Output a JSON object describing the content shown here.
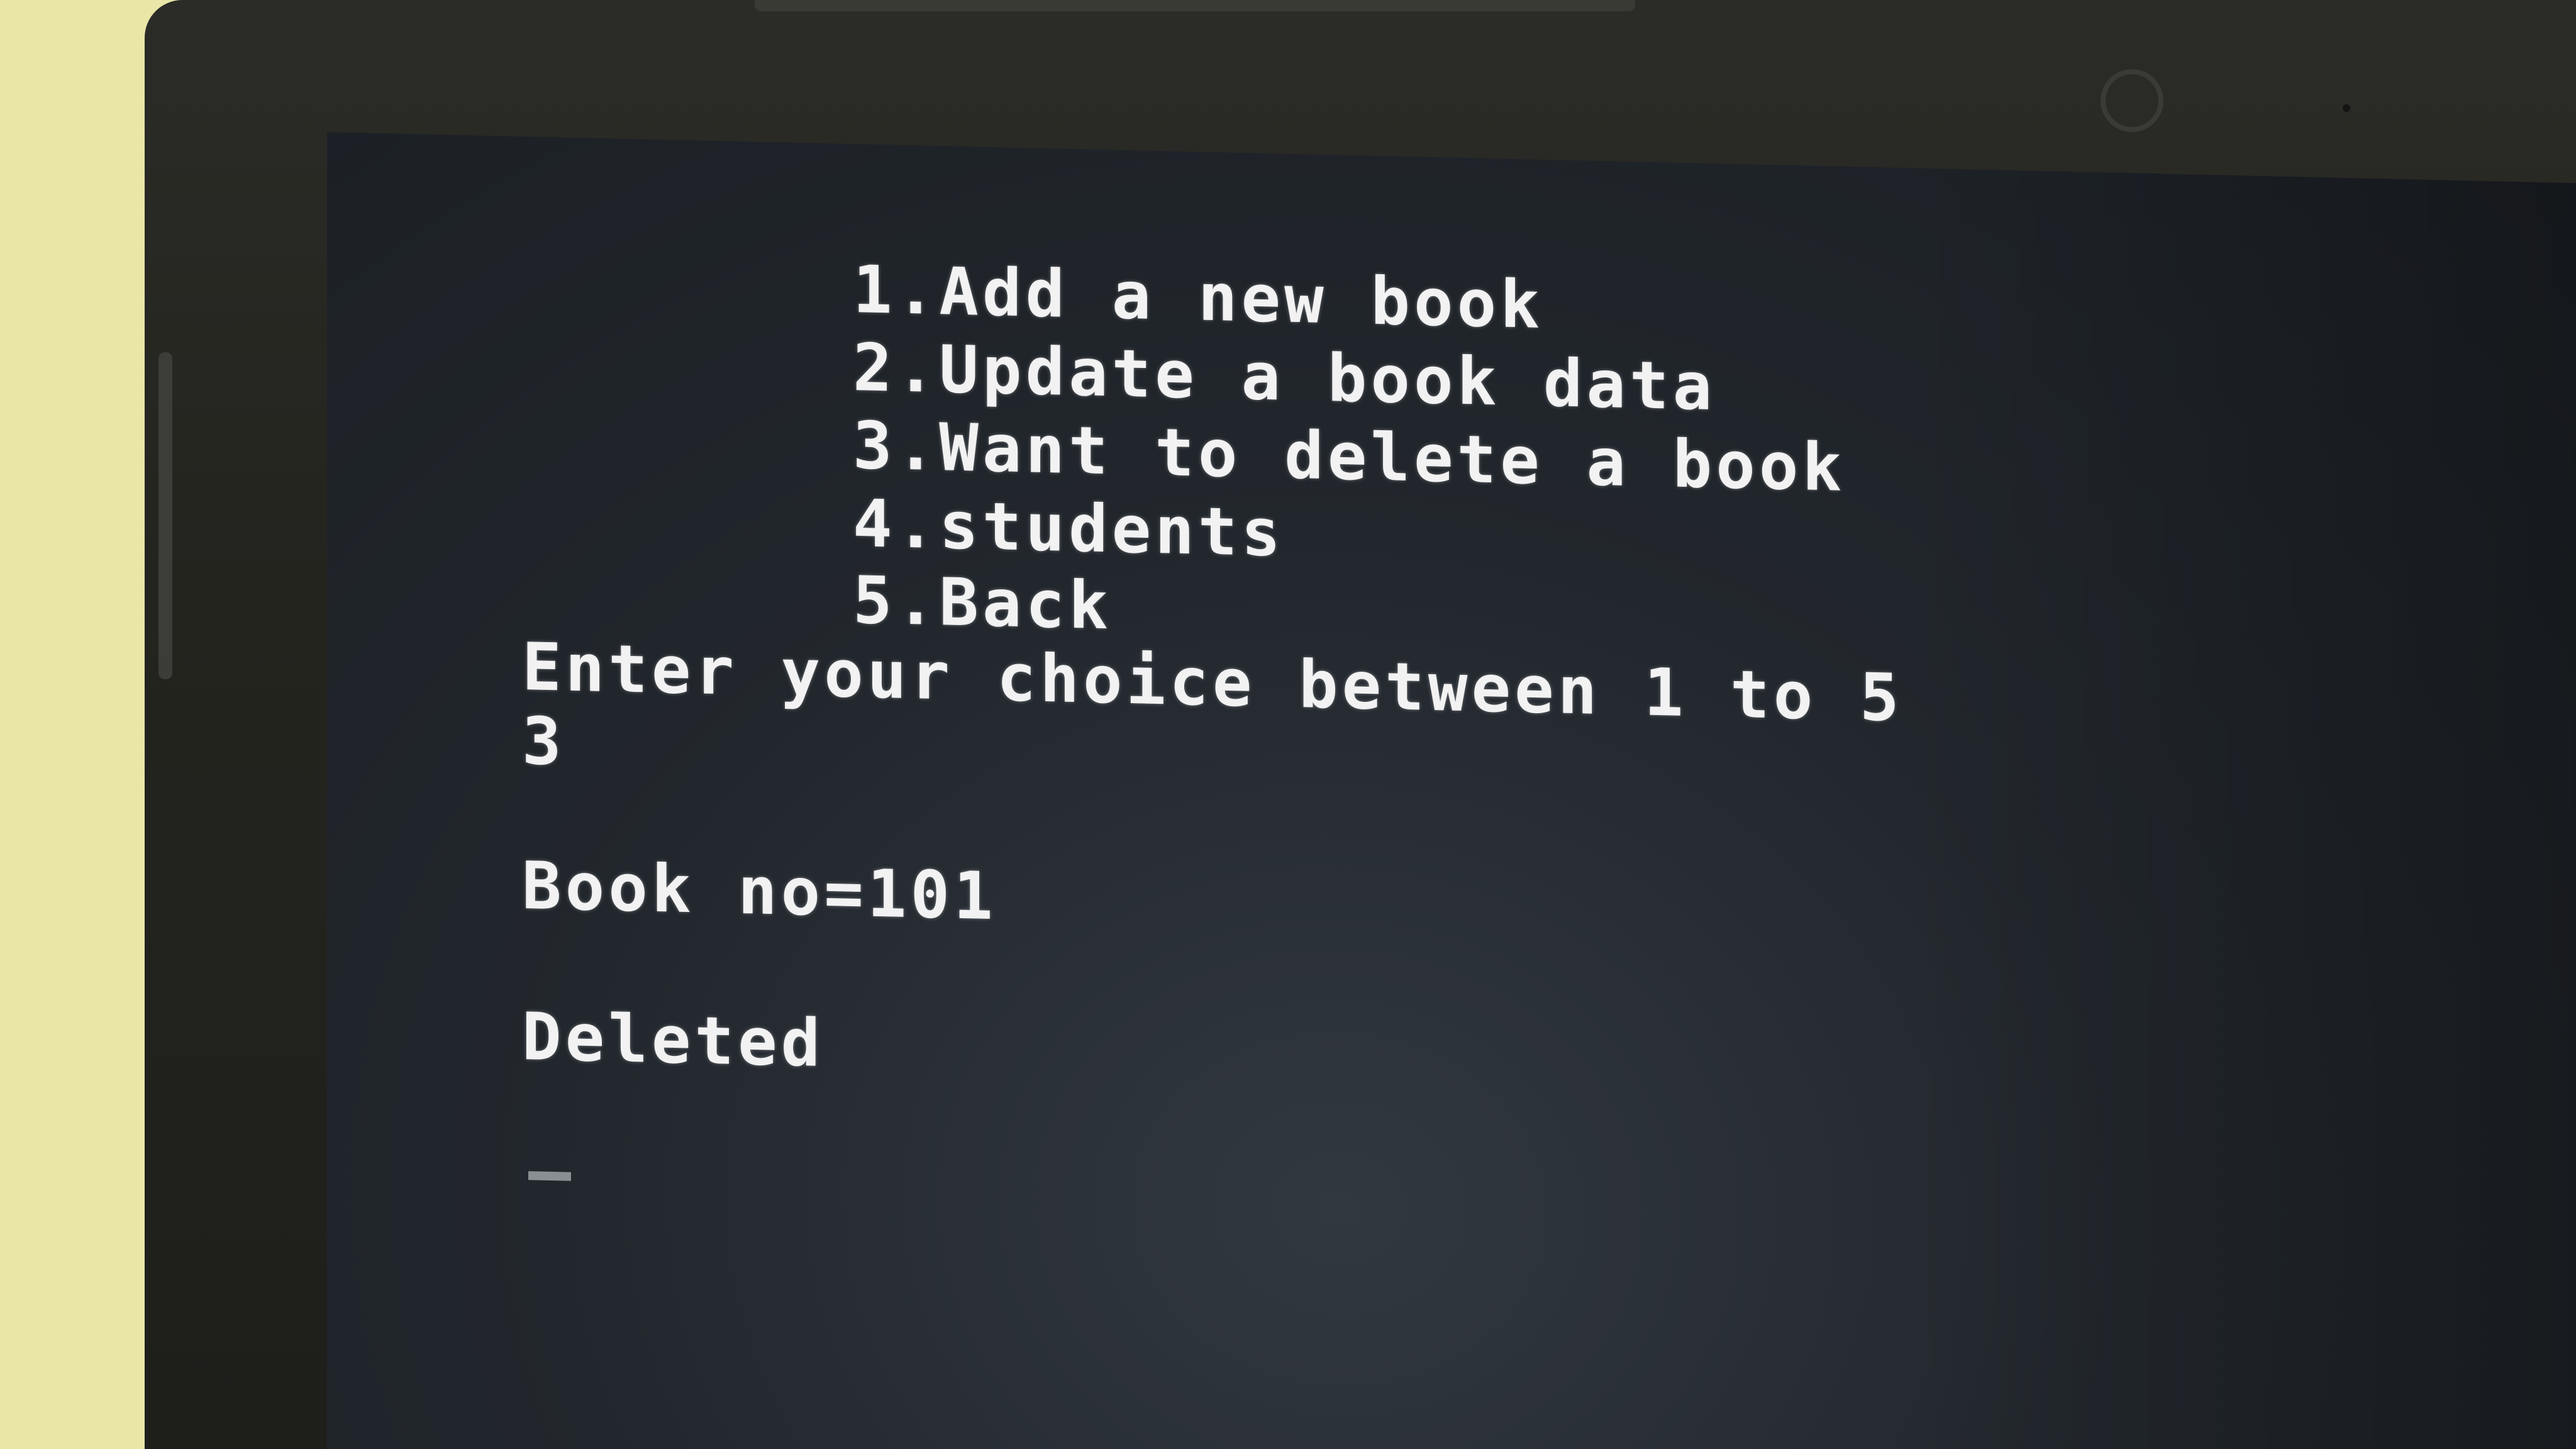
{
  "console": {
    "menu": [
      "1.Add a new book",
      "2.Update a book data",
      "3.Want to delete a book",
      "4.students",
      "5.Back"
    ],
    "prompt": "Enter your choice between 1 to 5",
    "input_value": "3",
    "book_no": "Book no=101",
    "status": "Deleted"
  },
  "colors": {
    "screen_background": "#22272d",
    "text": "#f2f2f2",
    "bezel": "#24241f",
    "wall": "#e9e6a6"
  }
}
